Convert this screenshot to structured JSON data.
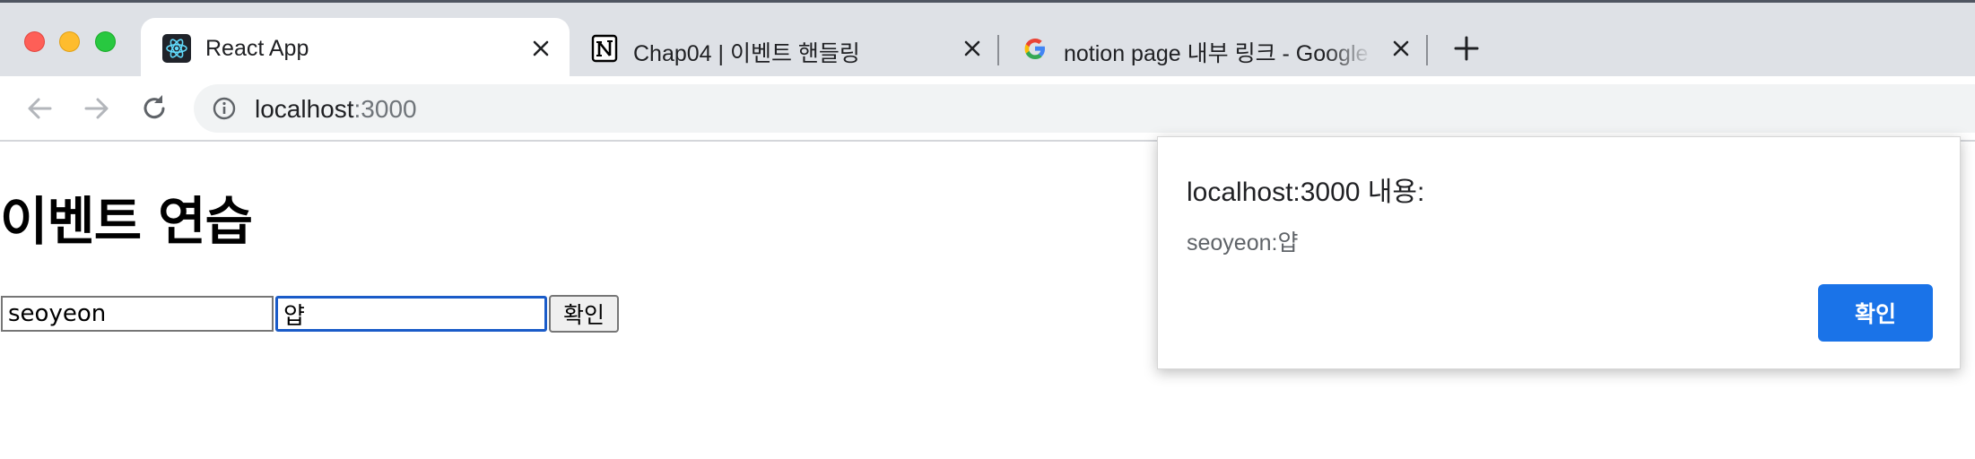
{
  "browser": {
    "tabs": [
      {
        "title": "React App",
        "favicon": "react-atom-icon",
        "active": true
      },
      {
        "title": "Chap04 | 이벤트 핸들링",
        "favicon": "notion-icon",
        "active": false
      },
      {
        "title": "notion page 내부 링크 - Google 검색",
        "favicon": "google-g-icon",
        "active": false
      }
    ],
    "address_bar": {
      "host": "localhost",
      "port": ":3000"
    }
  },
  "page": {
    "heading": "이벤트 연습",
    "name_input_value": "seoyeon",
    "message_input_value": "얍",
    "confirm_button_label": "확인"
  },
  "alert": {
    "title": "localhost:3000 내용:",
    "message": "seoyeon:얍",
    "ok_label": "확인"
  },
  "colors": {
    "accent": "#1a73e8",
    "tabstrip": "#dee1e6",
    "omnibox": "#f1f3f4"
  }
}
